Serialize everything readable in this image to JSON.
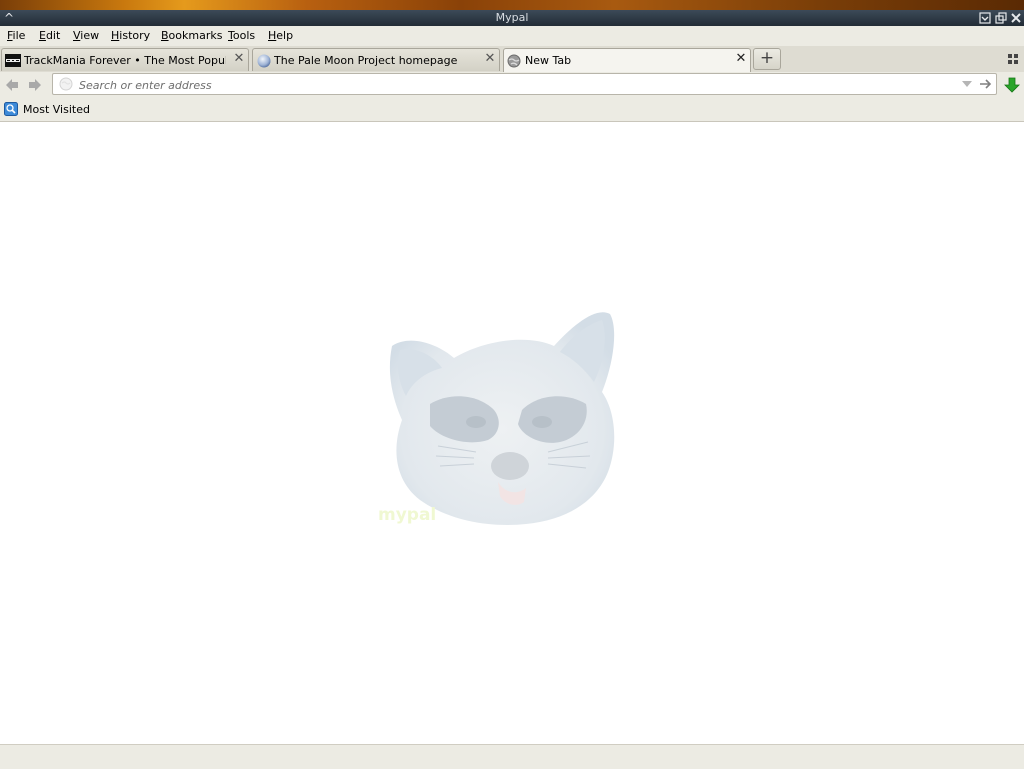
{
  "window": {
    "title": "Mypal",
    "controls": [
      "minimize-icon",
      "restore-icon",
      "close-icon"
    ]
  },
  "menu": {
    "items": [
      {
        "underline": "F",
        "rest": "ile"
      },
      {
        "underline": "E",
        "rest": "dit"
      },
      {
        "underline": "V",
        "rest": "iew"
      },
      {
        "underline": "H",
        "rest": "istory"
      },
      {
        "underline": "B",
        "rest": "ookmarks"
      },
      {
        "underline": "T",
        "rest": "ools"
      },
      {
        "underline": "H",
        "rest": "elp"
      }
    ]
  },
  "tabs": [
    {
      "label": "TrackMania Forever • The Most Popular ...",
      "favicon": "trackmania-favicon-icon",
      "active": false
    },
    {
      "label": "The Pale Moon Project homepage",
      "favicon": "pale-moon-favicon-icon",
      "active": false
    },
    {
      "label": "New Tab",
      "favicon": "globe-icon",
      "active": true
    }
  ],
  "nav": {
    "url_value": "",
    "url_placeholder": "Search or enter address"
  },
  "bookmarks": {
    "most_visited": "Most Visited"
  },
  "content": {
    "logo_text": "mypal"
  },
  "colors": {
    "titlebar": "#2c3844",
    "download_arrow": "#2aa52a",
    "content_background": "#ffffff"
  }
}
